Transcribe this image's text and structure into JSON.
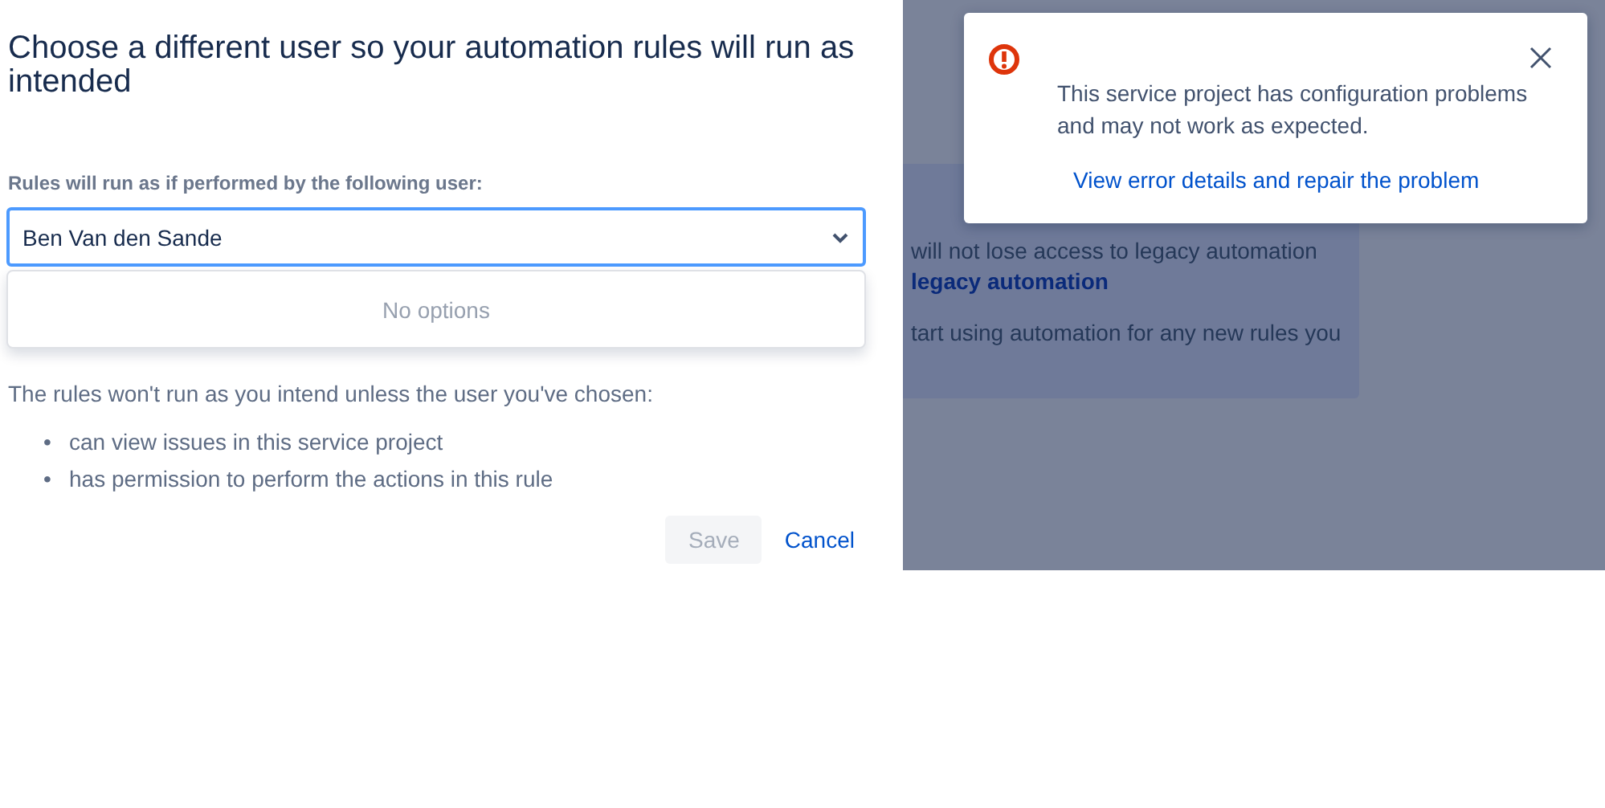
{
  "dialog": {
    "title": "Choose a different user so your automation rules will run as intended",
    "field_label": "Rules will run as if performed by the following user:",
    "user_select": {
      "value": "Ben Van den Sande",
      "expanded": true
    },
    "menu": {
      "empty_text": "No options"
    },
    "requirements_intro": "The rules won't run as you intend unless the user you've chosen:",
    "requirements": [
      {
        "marker": "•",
        "text": "can view issues in this service project"
      },
      {
        "marker": "•",
        "text": "has permission to perform the actions in this rule"
      }
    ],
    "buttons": [
      {
        "label": "Save",
        "kind": "primary",
        "disabled": true
      },
      {
        "label": "Cancel",
        "kind": "link",
        "disabled": false
      }
    ]
  },
  "background_card": {
    "lines": [
      {
        "text": "will not lose access to legacy automation",
        "kind": "text"
      },
      {
        "text": "legacy automation",
        "kind": "link"
      },
      {
        "text": "tart using automation for any new rules you",
        "kind": "text"
      }
    ]
  },
  "flag": {
    "message": "This service project has configuration problems and may not work as expected.",
    "link": "View error details and repair the problem"
  }
}
